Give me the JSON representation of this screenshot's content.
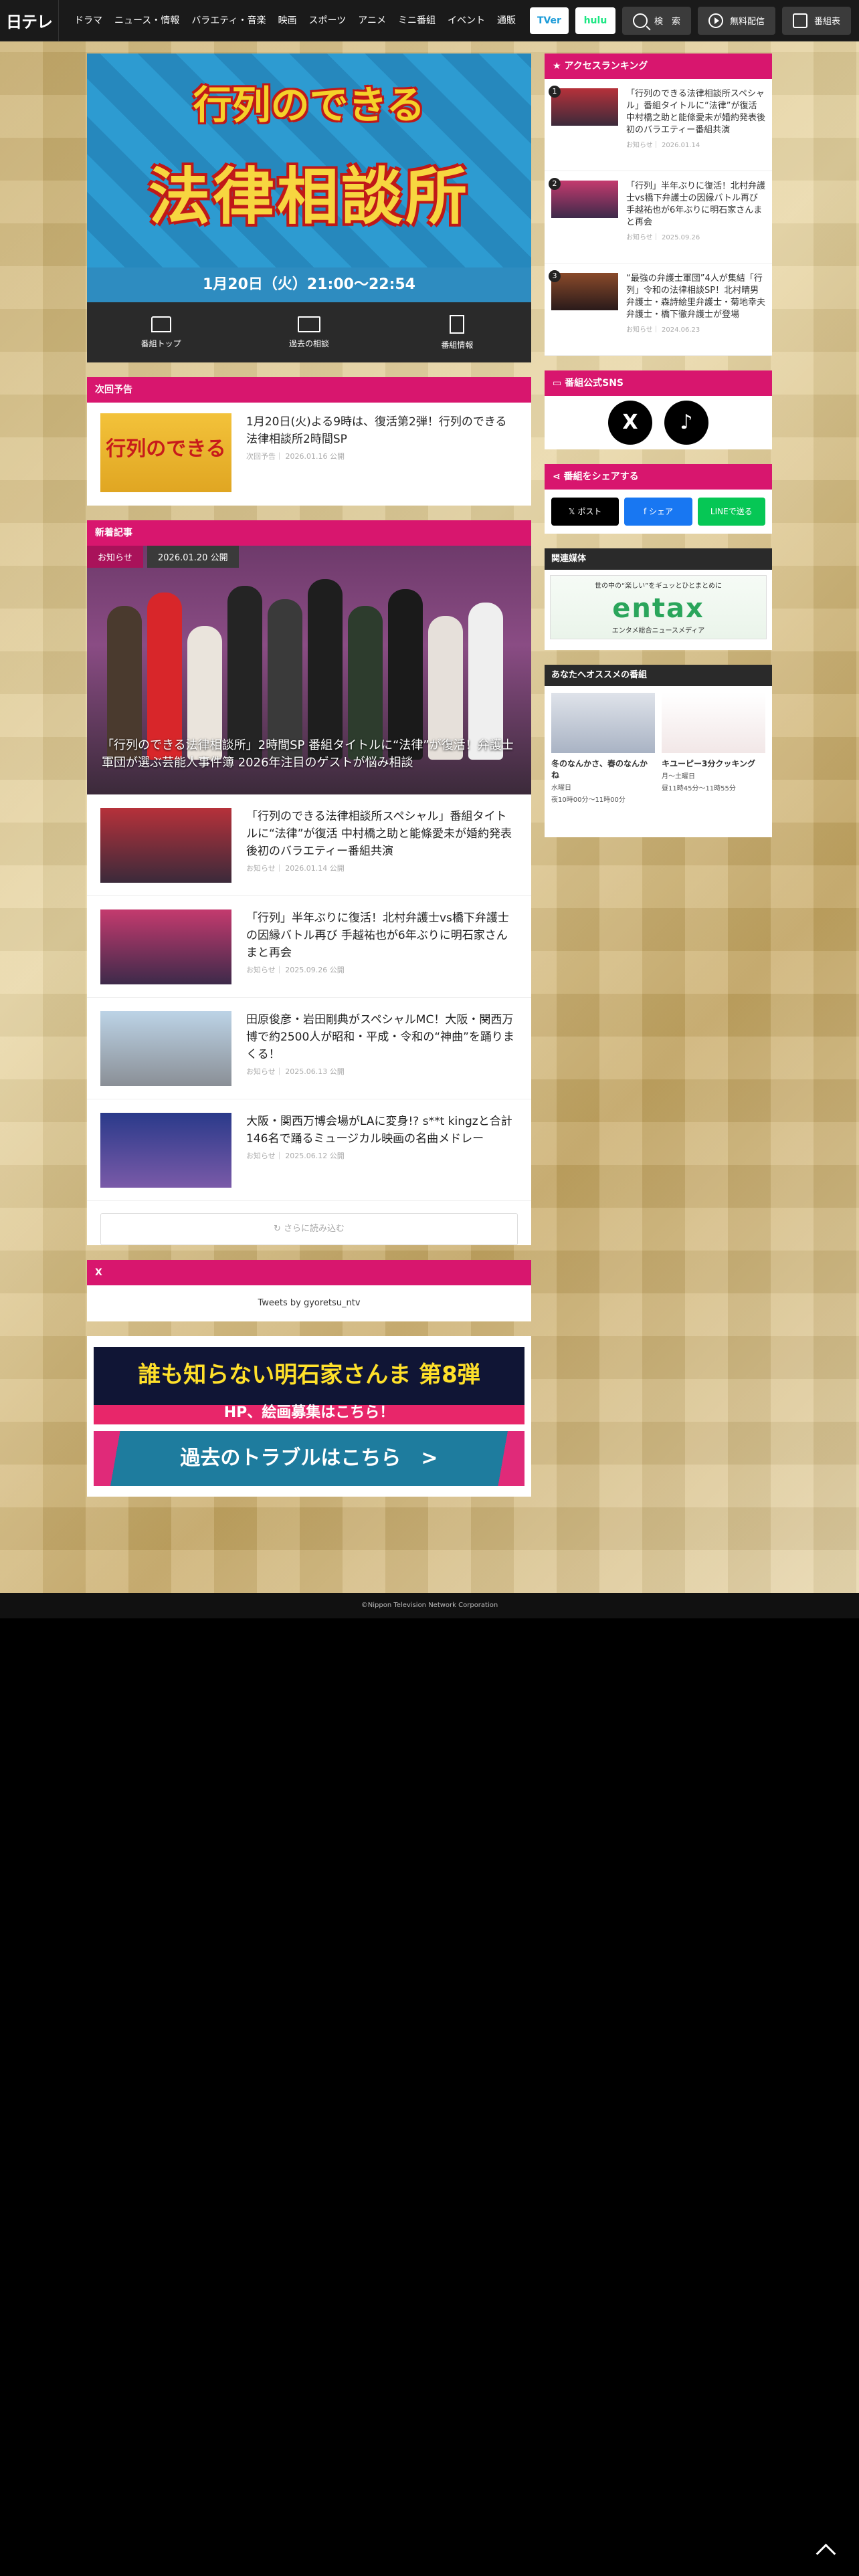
{
  "nav": {
    "logo": "日テレ",
    "links": [
      "ドラマ",
      "ニュース・情報",
      "バラエティ・音楽",
      "映画",
      "スポーツ",
      "アニメ",
      "ミニ番組",
      "イベント",
      "通販"
    ],
    "tver": "TVer",
    "hulu": "hulu",
    "search": "検　索",
    "free": "無料配信",
    "schedule": "番組表"
  },
  "hero": {
    "title1": "行列のできる",
    "title2": "法律相談所",
    "date": "1月20日（火）21:00〜22:54",
    "tabs": [
      {
        "label": "番組トップ"
      },
      {
        "label": "過去の相談"
      },
      {
        "label": "番組情報"
      }
    ]
  },
  "next": {
    "head": "次回予告",
    "title": "1月20日(火)よる9時は、復活第2弾！行列のできる法律相談所2時間SP",
    "meta": "次回予告｜ 2026.01.16 公開",
    "thumb_text": "行列のできる"
  },
  "news": {
    "head": "新着記事",
    "feature": {
      "category": "お知らせ",
      "date": "2026.01.20 公開",
      "caption": "「行列のできる法律相談所」2時間SP 番組タイトルに“法律”が復活！弁護士軍団が選ぶ芸能人事件簿 2026年注目のゲストが悩み相談"
    },
    "items": [
      {
        "title": "「行列のできる法律相談所スペシャル」番組タイトルに“法律”が復活 中村橋之助と能條愛未が婚約発表後初のバラエティー番組共演",
        "meta": "お知らせ｜ 2026.01.14 公開"
      },
      {
        "title": "「行列」半年ぶりに復活！北村弁護士vs橋下弁護士の因縁バトル再び 手越祐也が6年ぶりに明石家さんまと再会",
        "meta": "お知らせ｜ 2025.09.26 公開"
      },
      {
        "title": "田原俊彦・岩田剛典がスペシャルMC！大阪・関西万博で約2500人が昭和・平成・令和の“神曲”を踊りまくる！",
        "meta": "お知らせ｜ 2025.06.13 公開"
      },
      {
        "title": "大阪・関西万博会場がLAに変身!? s**t kingzと合計146名で踊るミュージカル映画の名曲メドレー",
        "meta": "お知らせ｜ 2025.06.12 公開"
      }
    ],
    "more": "さらに読み込む"
  },
  "x": {
    "head": "X",
    "body": "Tweets by gyoretsu_ntv"
  },
  "banners": {
    "b1_title": "誰も知らない明石家さんま 第8弾",
    "b1_sub": "HP、絵画募集はこちら！",
    "b2": "過去のトラブルはこちら　>"
  },
  "ranking": {
    "head": "アクセスランキング",
    "items": [
      {
        "num": "1",
        "title": "「行列のできる法律相談所スペシャル」番組タイトルに“法律”が復活 中村橋之助と能條愛未が婚約発表後初のバラエティー番組共演",
        "meta": "お知らせ｜ 2026.01.14"
      },
      {
        "num": "2",
        "title": "「行列」半年ぶりに復活！北村弁護士vs橋下弁護士の因縁バトル再び 手越祐也が6年ぶりに明石家さんまと再会",
        "meta": "お知らせ｜ 2025.09.26"
      },
      {
        "num": "3",
        "title": "“最強の弁護士軍団”4人が集結「行列」令和の法律相談SP！北村晴男弁護士・森詩絵里弁護士・菊地幸夫弁護士・橋下徹弁護士が登場",
        "meta": "お知らせ｜ 2024.06.23"
      }
    ]
  },
  "sns": {
    "head": "番組公式SNS",
    "x": "X",
    "tiktok": "♪"
  },
  "share": {
    "head": "番組をシェアする",
    "post": "ポスト",
    "fb": "シェア",
    "line": "LINEで送る"
  },
  "related": {
    "head": "関連媒体",
    "line1": "世の中の“楽しい”をギュッとひとまとめに",
    "brand": "entax",
    "line2": "エンタメ総合ニュースメディア"
  },
  "recommend": {
    "head": "あなたへオススメの番組",
    "items": [
      {
        "title": "冬のなんかさ、春のなんかね",
        "day": "水曜日",
        "time": "夜10時00分〜11時00分"
      },
      {
        "title": "キユーピー3分クッキング",
        "day": "月〜土曜日",
        "time": "昼11時45分〜11時55分"
      }
    ]
  },
  "footer": {
    "copyright": "©Nippon Television Network Corporation"
  },
  "colors": {
    "accent": "#d8166e",
    "nav_bg": "#1a1a1a",
    "hero_blue": "#2e8cc0"
  }
}
